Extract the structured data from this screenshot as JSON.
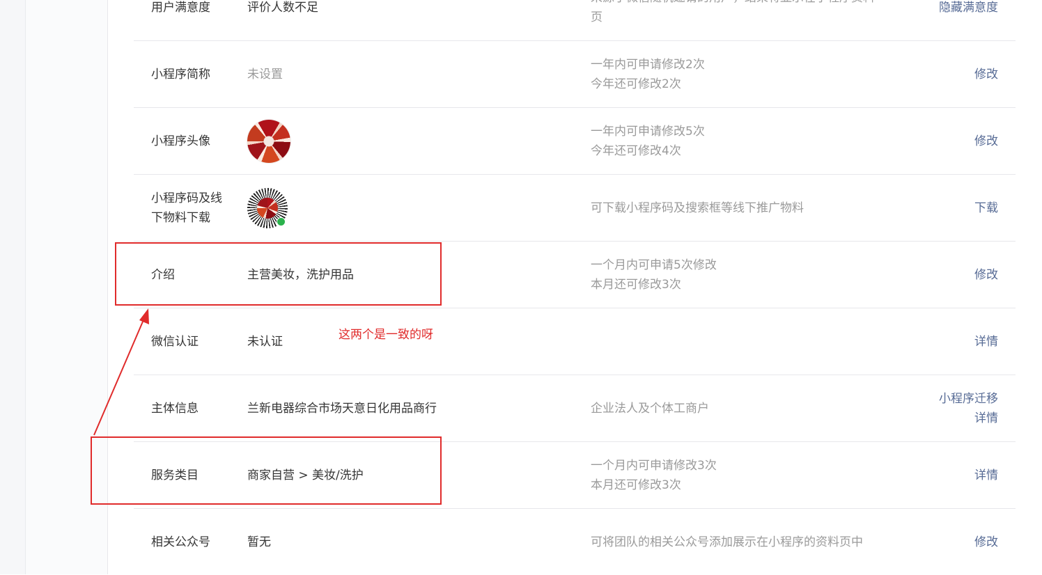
{
  "rows": [
    {
      "label": "用户满意度",
      "value": "评价人数不足",
      "note": [
        "来源于微信随机邀请的用户，结果将显示在小程序资料",
        "页"
      ],
      "action": [
        "隐藏满意度"
      ]
    },
    {
      "label": "小程序简称",
      "value": "未设置",
      "note": [
        "一年内可申请修改2次",
        "今年还可修改2次"
      ],
      "action": [
        "修改"
      ]
    },
    {
      "label": "小程序头像",
      "value": "",
      "note": [
        "一年内可申请修改5次",
        "今年还可修改4次"
      ],
      "action": [
        "修改"
      ]
    },
    {
      "label": [
        "小程序码及线",
        "下物料下载"
      ],
      "value": "",
      "note": [
        "可下载小程序码及搜索框等线下推广物料"
      ],
      "action": [
        "下载"
      ]
    },
    {
      "label": "介绍",
      "value": "主营美妆，洗护用品",
      "note": [
        "一个月内可申请5次修改",
        "本月还可修改3次"
      ],
      "action": [
        "修改"
      ]
    },
    {
      "label": "微信认证",
      "value": "未认证",
      "note": [],
      "action": [
        "详情"
      ]
    },
    {
      "label": "主体信息",
      "value": "兰新电器综合市场天意日化用品商行",
      "note": [
        "企业法人及个体工商户"
      ],
      "action": [
        "小程序迁移",
        "详情"
      ]
    },
    {
      "label": "服务类目",
      "value": "商家自营 > 美妆/洗护",
      "note": [
        "一个月内可申请修改3次",
        "本月还可修改3次"
      ],
      "action": [
        "详情"
      ]
    },
    {
      "label": "相关公众号",
      "value": "暂无",
      "note": [
        "可将团队的相关公众号添加展示在小程序的资料页中"
      ],
      "action": [
        "修改"
      ]
    }
  ],
  "annotation": {
    "text": "这两个是一致的呀"
  },
  "colors": {
    "link": "#576b95",
    "annotation": "#e02b2b",
    "muted": "#9a9a9a"
  },
  "icons": {
    "avatar": "flower-logo-avatar",
    "qrcode": "mini-program-code"
  }
}
